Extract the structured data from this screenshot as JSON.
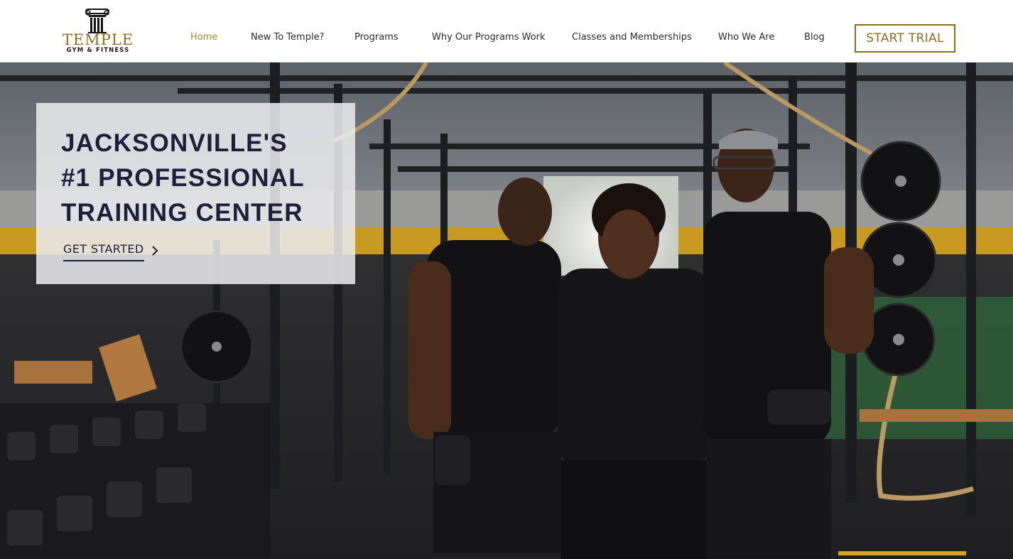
{
  "brand": {
    "name": "TEMPLE",
    "tagline": "GYM & FITNESS",
    "logo_icon": "column-capital-icon"
  },
  "nav": {
    "items": [
      {
        "label": "Home",
        "active": true
      },
      {
        "label": "New To Temple?"
      },
      {
        "label": "Programs"
      },
      {
        "label": "Why Our Programs Work"
      },
      {
        "label": "Classes and Memberships"
      },
      {
        "label": "Who We Are"
      },
      {
        "label": "Blog"
      }
    ],
    "cta_label": "START TRIAL"
  },
  "hero": {
    "headline_lines": [
      "JACKSONVILLE'S",
      "#1 PROFESSIONAL",
      "TRAINING CENTER"
    ],
    "button_label": "GET STARTED",
    "button_icon": "chevron-right-icon",
    "image_description": "three trainers standing in a gym"
  },
  "colors": {
    "accent_gold": "#8c6d1f",
    "active_nav": "#a6842a",
    "headline_navy": "#1e1e3c",
    "nav_text": "#2a2a2a"
  }
}
